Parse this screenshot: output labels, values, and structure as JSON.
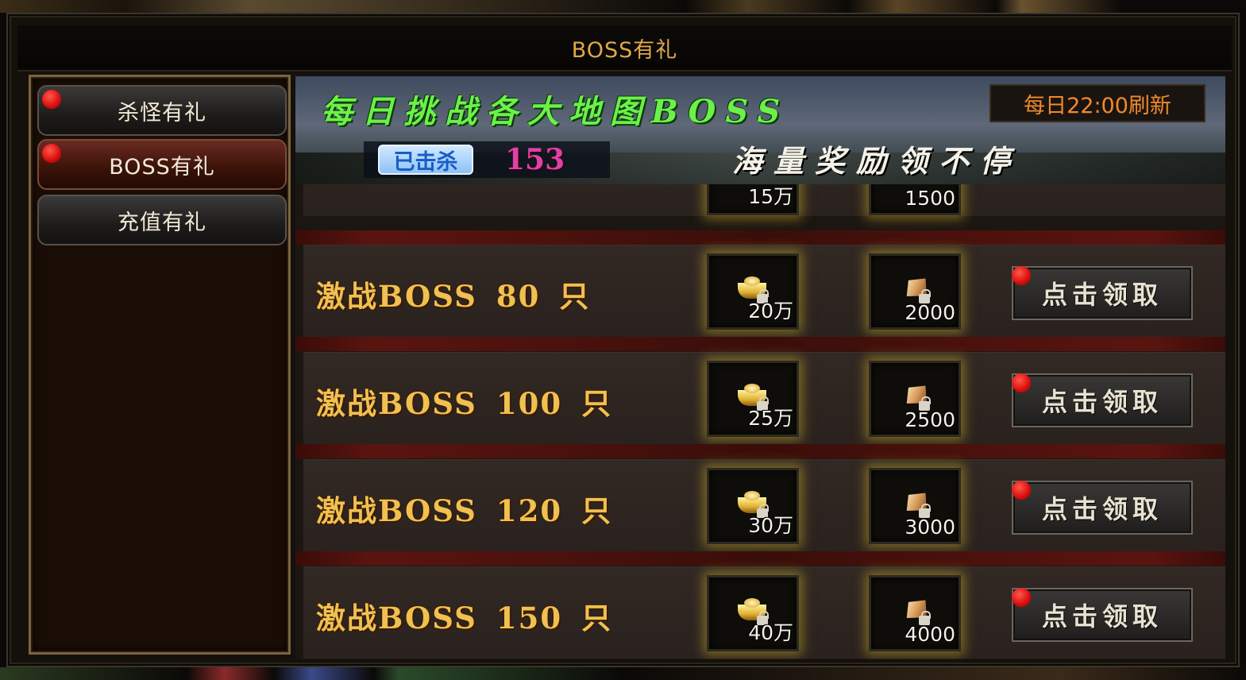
{
  "window": {
    "title": "BOSS有礼"
  },
  "sidebar": {
    "tabs": [
      {
        "label": "杀怪有礼",
        "active": false,
        "has_notification": true
      },
      {
        "label": "BOSS有礼",
        "active": true,
        "has_notification": true
      },
      {
        "label": "充值有礼",
        "active": false,
        "has_notification": false
      }
    ]
  },
  "banner": {
    "headline": "每日挑战各大地图BOSS",
    "refresh": "每日22:00刷新",
    "killed_label": "已击杀",
    "killed_count": "153",
    "slogan": "海量奖励领不停"
  },
  "rewards": {
    "partial_row": {
      "gold": "15万",
      "gem": "1500"
    },
    "rows": [
      {
        "prefix": "激战BOSS",
        "count": "80",
        "unit": "只",
        "gold": "20万",
        "gem": "2000",
        "button": "点击领取"
      },
      {
        "prefix": "激战BOSS",
        "count": "100",
        "unit": "只",
        "gold": "25万",
        "gem": "2500",
        "button": "点击领取"
      },
      {
        "prefix": "激战BOSS",
        "count": "120",
        "unit": "只",
        "gold": "30万",
        "gem": "3000",
        "button": "点击领取"
      },
      {
        "prefix": "激战BOSS",
        "count": "150",
        "unit": "只",
        "gold": "40万",
        "gem": "4000",
        "button": "点击领取"
      }
    ]
  },
  "colors": {
    "accent_gold": "#f0c050",
    "title": "#e0a84c",
    "headline_green": "#6cf04a",
    "refresh_orange": "#f08a2c",
    "count_pink": "#e040a8",
    "notification_red": "#d80c0c"
  },
  "icons": {
    "gold_item": "gold-ingot-icon",
    "gem_item": "gem-icon",
    "lock": "lock-icon",
    "notification": "red-dot"
  }
}
